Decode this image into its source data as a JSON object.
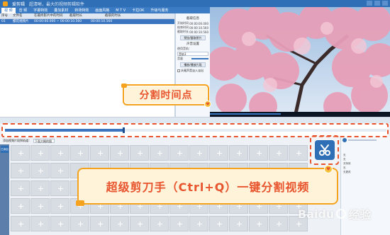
{
  "window": {
    "title": "爱剪辑",
    "subtitle": "超清晰，最大的视频剪辑软件"
  },
  "menubar": {
    "tabs": [
      "视 频",
      "音 频",
      "字幕特效",
      "叠加素材",
      "转场特效",
      "画面风格",
      "M T V",
      "卡拉OK",
      "升级与服务"
    ]
  },
  "clips_table": {
    "headers": [
      "序号",
      "文件名",
      "在最终影片中的时间",
      "截取时长",
      "截取的时长"
    ],
    "rows": [
      [
        "01",
        "樱花视频片段.mp4",
        "00:00:00.000 ~ 00:00:10.560",
        "00:00:10.560",
        ""
      ]
    ]
  },
  "params": {
    "title": "截取信息",
    "rows": [
      {
        "label": "开始时间",
        "value": "00:00:00.000"
      },
      {
        "label": "结束时间",
        "value": "00:00:10.560"
      },
      {
        "label": "截取时长",
        "value": "00:00:10.560"
      }
    ],
    "btn1": "预览/截取原片",
    "audio_title": "声音设置",
    "audio_label": "使用音轨：",
    "audio_select": "音轨1",
    "volume_label": "音量",
    "btn2": "播放/播放片段",
    "checkbox": "头尾声音淡入淡出"
  },
  "callouts": {
    "split_point": "分割时间点",
    "shortcut_hint": "超级剪刀手（Ctrl+Q）一键分割视频"
  },
  "timeline": {
    "progress": 0.31
  },
  "toolbar2": {
    "label": "添加视频片段到轨道：",
    "select": "下面大概的图"
  },
  "sidebar2": {
    "label": "已添加"
  },
  "rightmini": {
    "items": [
      "无",
      "无",
      "无特效",
      "无",
      "无更改"
    ]
  },
  "watermark": {
    "brand": "Baidu",
    "suffix": "经验"
  },
  "colors": {
    "accent": "#2f6fb6",
    "callout_text": "#e8542e",
    "callout_border": "#f5a31f"
  },
  "icons": {
    "cut": "scissors-icon"
  }
}
